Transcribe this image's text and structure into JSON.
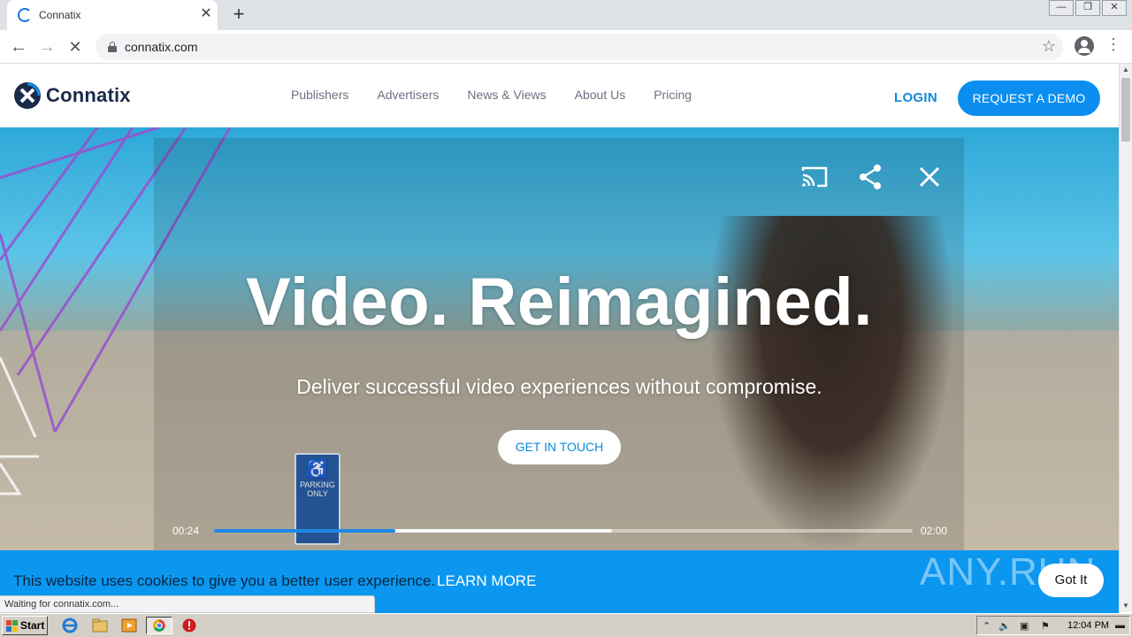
{
  "browser": {
    "tab_title": "Connatix",
    "tab_close": "✕",
    "new_tab": "+",
    "url": "connatix.com",
    "win_minimize": "—",
    "win_restore": "❐",
    "win_close": "✕"
  },
  "site": {
    "logo_text": "Connatix",
    "nav": [
      "Publishers",
      "Advertisers",
      "News & Views",
      "About Us",
      "Pricing"
    ],
    "login": "LOGIN",
    "demo_button": "REQUEST A DEMO"
  },
  "hero": {
    "title": "Video. Reimagined.",
    "subtitle": "Deliver successful video experiences without compromise.",
    "cta": "GET IN TOUCH",
    "sign_line1": "PARKING",
    "sign_line2": "ONLY"
  },
  "player": {
    "time_current": "00:24",
    "time_total": "02:00",
    "progress": 0.26,
    "buffered": 0.57
  },
  "cookie": {
    "text": "This website uses cookies to give you a better user experience.",
    "link": "LEARN MORE",
    "button": "Got It"
  },
  "watermark": "ANY.RUN",
  "status_bar": "Waiting for connatix.com...",
  "taskbar": {
    "start": "Start",
    "clock": "12:04 PM"
  },
  "colors": {
    "brand_blue": "#0b8ef0",
    "logo_dark": "#1b2a4a",
    "hero_deco": "#9a4fd0",
    "progress": "#1e88e5"
  }
}
